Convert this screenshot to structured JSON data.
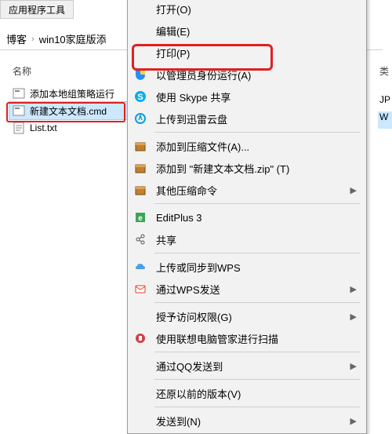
{
  "toolbar": {
    "tab": "应用程序工具"
  },
  "breadcrumb": {
    "a": "博客",
    "b": "win10家庭版添"
  },
  "columns": {
    "name": "名称",
    "right": "类"
  },
  "files": {
    "f0": "添加本地组策略运行",
    "f1": "新建文本文档.cmd",
    "f2": "List.txt"
  },
  "right_strip": {
    "r0": "JP",
    "r1": "W"
  },
  "menu": {
    "open": "打开(O)",
    "edit": "编辑(E)",
    "print": "打印(P)",
    "run_admin": "以管理员身份运行(A)",
    "skype": "使用 Skype 共享",
    "xunlei": "上传到迅雷云盘",
    "zip_add": "添加到压缩文件(A)...",
    "zip_to": "添加到 \"新建文本文档.zip\" (T)",
    "zip_other": "其他压缩命令",
    "editplus": "EditPlus 3",
    "share": "共享",
    "wps_upload": "上传或同步到WPS",
    "wps_send": "通过WPS发送",
    "grant": "授予访问权限(G)",
    "lenovo": "使用联想电脑管家进行扫描",
    "qq_send": "通过QQ发送到",
    "restore": "还原以前的版本(V)",
    "send_to": "发送到(N)"
  },
  "glyph": {
    "submenu": "▶"
  }
}
